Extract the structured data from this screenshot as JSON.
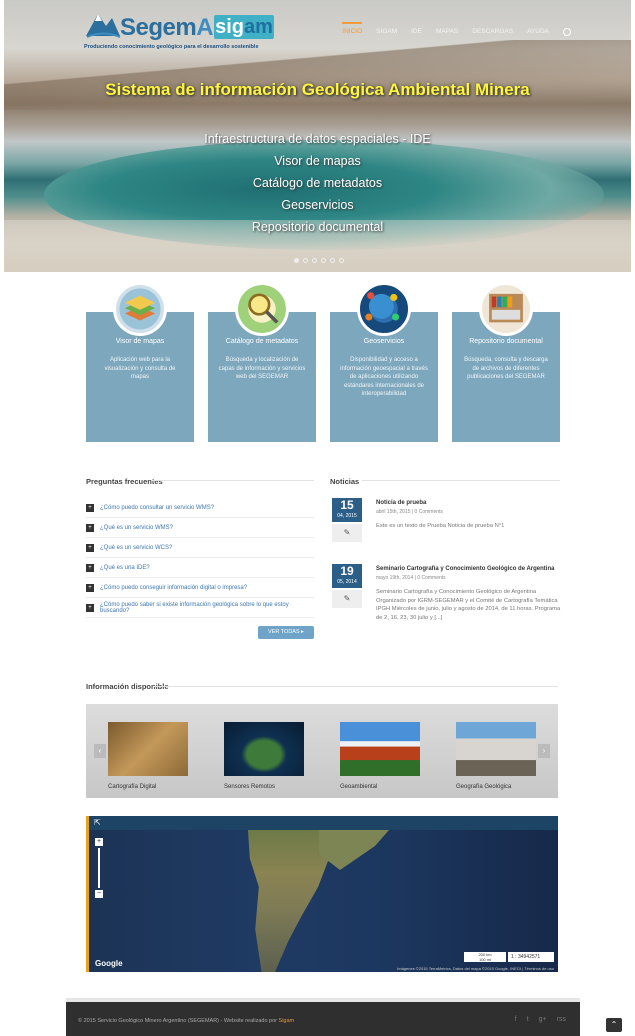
{
  "header": {
    "logo_segem": "Segem",
    "logo_ar": "AR",
    "logo_sig": "sig",
    "logo_am": "am",
    "logo_tagline": "Produciendo conocimiento geológico para el desarrollo sostenible"
  },
  "nav": {
    "items": [
      "INICIO",
      "SIGAM",
      "IDE",
      "MAPAS",
      "DESCARGAS",
      "AYUDA"
    ]
  },
  "hero": {
    "title": "Sistema de información Geológica Ambiental Minera",
    "links": [
      "Infraestructura de datos espaciales - IDE",
      "Visor de mapas",
      "Catálogo de metadatos",
      "Geoservicios",
      "Repositorio documental"
    ]
  },
  "features": [
    {
      "title": "Visor de mapas",
      "desc": "Aplicación web para la visualización y consulta de mapas",
      "icon": "layers-globe-icon"
    },
    {
      "title": "Catálogo de metadatos",
      "desc": "Búsqueda y localización de capas de información y servicios web del SEGEMAR",
      "icon": "magnifier-map-icon"
    },
    {
      "title": "Geoservicios",
      "desc": "Disponibilidad y acceso a información geoespacial a través de aplicaciones utilizando estándares internacionales de interoperabilidad",
      "icon": "globe-network-icon"
    },
    {
      "title": "Repositorio documental",
      "desc": "Búsqueda, consulta y descarga de archivos de diferentes publicaciones del SEGEMAR",
      "icon": "bookshelf-icon"
    }
  ],
  "faq": {
    "title": "Preguntas frecuentes",
    "items": [
      "¿Cómo puedo consultar un servicio WMS?",
      "¿Qué es un servicio WMS?",
      "¿Qué es un servicio WCS?",
      "¿Qué es una IDE?",
      "¿Cómo puedo conseguir información digital o impresa?",
      "¿Cómo puedo saber si existe información geológica sobre lo que estoy buscando?"
    ],
    "button": "VER TODAS"
  },
  "news": {
    "title": "Noticias",
    "items": [
      {
        "day": "15",
        "month": "04, 2015",
        "title": "Noticia de prueba",
        "meta": "abril 15th, 2015 | 0 Comments",
        "text": "Este es un texto de Prueba Noticia de prueba N°1"
      },
      {
        "day": "19",
        "month": "05, 2014",
        "title": "Seminario Cartografía y Conocimiento Geológico de Argentina",
        "meta": "mayo 19th, 2014 | 0 Comments",
        "text": "Seminario Cartografía y Conocimiento Geológico de Argentina Organizado por IGRM-SEGEMAR y el Comité de Cartografía Temática IPGH Miércoles de junio, julio y agosto de 2014, de 11 horas. Programa de 2, 16, 23, 30 julio y [...]"
      }
    ]
  },
  "info": {
    "title": "Información disponible",
    "items": [
      "Cartografía Digital",
      "Sensores Remotos",
      "Geoambiental",
      "Geografía Geológica"
    ]
  },
  "map": {
    "google": "Google",
    "scale_top": "200 km",
    "scale_bottom": "100 mi",
    "scale_ratio": "1 : 34942571",
    "copyright": "Imágenes ©2015 TerraMetrics, Datos del mapa ©2015 Google, INEGI | Términos de uso"
  },
  "footer": {
    "copy": "© 2015 Servicio Geológico Minero Argentino (SEGEMAR) - Website realizado por",
    "author": "Sigam",
    "social": [
      "f",
      "t",
      "g+",
      "rss"
    ]
  }
}
